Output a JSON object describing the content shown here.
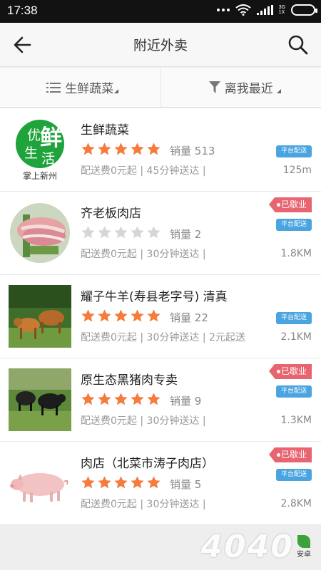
{
  "status_bar": {
    "time": "17:38",
    "network_label": "3G",
    "network_sub": "1X"
  },
  "header": {
    "title": "附近外卖"
  },
  "filters": [
    {
      "label": "生鲜蔬菜",
      "icon": "list-icon"
    },
    {
      "label": "离我最近",
      "icon": "funnel-icon"
    }
  ],
  "stores": [
    {
      "name": "生鲜蔬菜",
      "rating": 5,
      "sales_label": "销量",
      "sales": "513",
      "delivery_fee": "配送费0元起",
      "delivery_time": "45分钟送达",
      "min_order": "",
      "distance": "125m",
      "platform_badge": "平台配送",
      "closed": false,
      "closed_badge": "",
      "thumb": "logo-youxian",
      "logo_text": [
        "优",
        "鲜",
        "生",
        "活"
      ],
      "logo_caption": "掌上新州"
    },
    {
      "name": "齐老板肉店",
      "rating": 0,
      "sales_label": "销量",
      "sales": "2",
      "delivery_fee": "配送费0元起",
      "delivery_time": "30分钟送达",
      "min_order": "",
      "distance": "1.8KM",
      "platform_badge": "平台配送",
      "closed": true,
      "closed_badge": "已歇业",
      "thumb": "meat-photo"
    },
    {
      "name": "耀子牛羊(寿县老字号) 清真",
      "rating": 5,
      "sales_label": "销量",
      "sales": "22",
      "delivery_fee": "配送费0元起",
      "delivery_time": "30分钟送达",
      "min_order": "2元起送",
      "distance": "2.1KM",
      "platform_badge": "平台配送",
      "closed": false,
      "closed_badge": "",
      "thumb": "cattle-photo"
    },
    {
      "name": "原生态黑猪肉专卖",
      "rating": 5,
      "sales_label": "销量",
      "sales": "9",
      "delivery_fee": "配送费0元起",
      "delivery_time": "30分钟送达",
      "min_order": "",
      "distance": "1.3KM",
      "platform_badge": "平台配送",
      "closed": true,
      "closed_badge": "已歇业",
      "thumb": "black-pig-photo"
    },
    {
      "name": "肉店（北菜市涛子肉店）",
      "rating": 5,
      "sales_label": "销量",
      "sales": "5",
      "delivery_fee": "配送费0元起",
      "delivery_time": "30分钟送达",
      "min_order": "",
      "distance": "2.8KM",
      "platform_badge": "平台配送",
      "closed": true,
      "closed_badge": "已歇业",
      "thumb": "pink-pig-photo"
    }
  ],
  "watermark": {
    "text": "4040",
    "site": "安卓"
  },
  "colors": {
    "star_on": "#f47c3c",
    "star_off": "#d6d6d6",
    "platform_badge": "#4aa4e0",
    "closed_badge": "#e86470",
    "logo_green": "#1fa33b"
  }
}
